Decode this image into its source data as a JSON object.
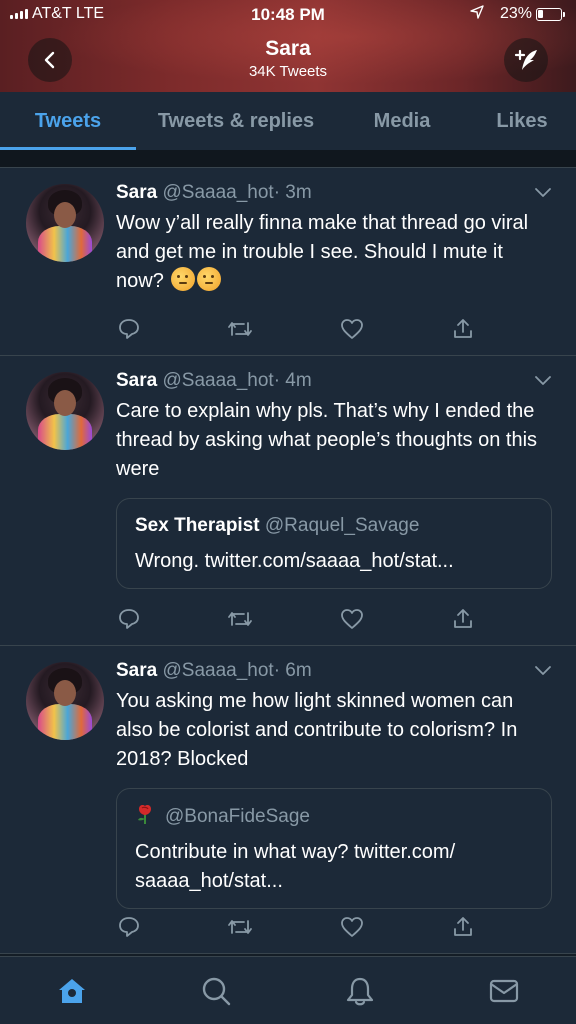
{
  "status_bar": {
    "carrier": "AT&T  LTE",
    "time": "10:48 PM",
    "battery": "23%"
  },
  "profile": {
    "name": "Sara",
    "tweet_count": "34K Tweets"
  },
  "tabs": [
    {
      "label": "Tweets",
      "active": true
    },
    {
      "label": "Tweets & replies",
      "active": false
    },
    {
      "label": "Media",
      "active": false
    },
    {
      "label": "Likes",
      "active": false
    }
  ],
  "tweets": [
    {
      "name": "Sara",
      "handle": "@Saaaa_hot",
      "time": "· 3m",
      "text": "Wow y’all really finna make that thread go viral and get me in trouble I see. Should I mute it now?"
    },
    {
      "name": "Sara",
      "handle": "@Saaaa_hot",
      "time": "· 4m",
      "text": "Care to explain why pls. That’s why I ended the thread by asking what people’s thoughts on this were",
      "quote": {
        "name": "Sex Therapist",
        "handle": "@Raquel_Savage",
        "text": "Wrong. twitter.com/saaaa_hot/stat..."
      }
    },
    {
      "name": "Sara",
      "handle": "@Saaaa_hot",
      "time": "· 6m",
      "text": "You asking me how light skinned women can also be colorist and contribute to colorism? In 2018? Blocked",
      "quote": {
        "handle": "@BonaFideSage",
        "text": "Contribute in what way? twitter.com/ saaaa_hot/stat..."
      }
    }
  ],
  "colors": {
    "background": "#141d26",
    "card": "#1c2938",
    "accent": "#4ba3eb",
    "muted": "#8899a6",
    "border": "#38444d"
  },
  "icons": {
    "back": "chevron-left-icon",
    "compose": "compose-icon",
    "more": "chevron-down-icon",
    "reply": "reply-icon",
    "retweet": "retweet-icon",
    "like": "heart-icon",
    "share": "share-icon",
    "home": "home-icon",
    "search": "search-icon",
    "notifications": "bell-icon",
    "messages": "mail-icon"
  }
}
